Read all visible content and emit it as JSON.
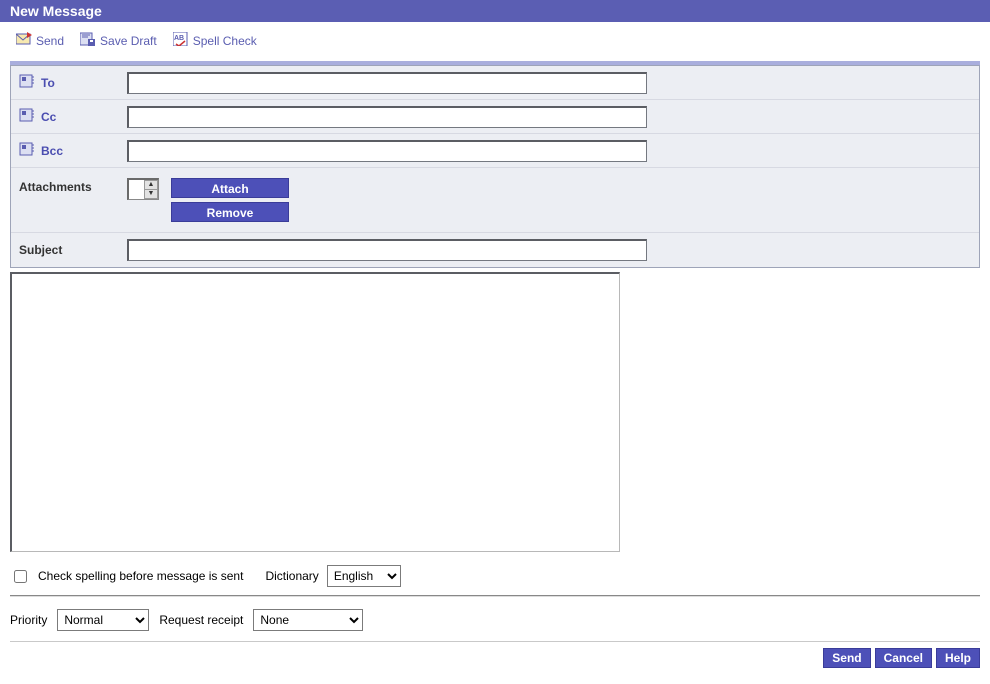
{
  "title": "New Message",
  "toolbar": {
    "send": "Send",
    "save_draft": "Save Draft",
    "spell_check": "Spell Check"
  },
  "fields": {
    "to_label": "To",
    "to_value": "",
    "cc_label": "Cc",
    "cc_value": "",
    "bcc_label": "Bcc",
    "bcc_value": "",
    "attachments_label": "Attachments",
    "attach_btn": "Attach",
    "remove_btn": "Remove",
    "subject_label": "Subject",
    "subject_value": ""
  },
  "body_value": "",
  "options": {
    "check_spelling_label": "Check spelling before message is sent",
    "check_spelling_checked": false,
    "dictionary_label": "Dictionary",
    "dictionary_value": "English",
    "priority_label": "Priority",
    "priority_value": "Normal",
    "request_receipt_label": "Request receipt",
    "request_receipt_value": "None"
  },
  "footer": {
    "send": "Send",
    "cancel": "Cancel",
    "help": "Help"
  }
}
